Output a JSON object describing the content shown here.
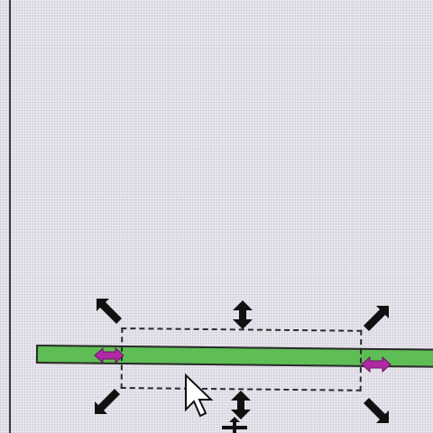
{
  "canvas": {
    "background": "#e9e6ee",
    "bar_color": "#5fbd55",
    "handle_color": "#111111",
    "node_color": "#b02aa6"
  },
  "icons": {
    "scale_handles": [
      "diagonal-resize-arrow",
      "vertical-resize-arrow"
    ],
    "side_nodes": [
      "horizontal-double-arrow"
    ],
    "pointer": [
      "arrow-cursor",
      "move-cursor"
    ]
  }
}
